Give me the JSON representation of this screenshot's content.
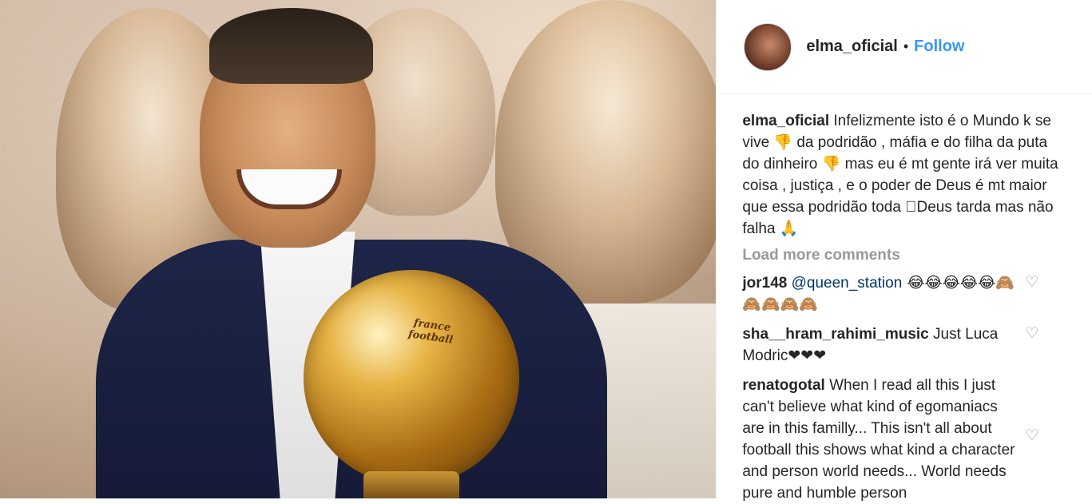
{
  "photo": {
    "trophy_text": "france football"
  },
  "header": {
    "username": "elma_oficial",
    "separator": "•",
    "follow_label": "Follow"
  },
  "caption": {
    "username": "elma_oficial",
    "text": "Infelizmente isto é o Mundo k se vive 👎 da podridão , máfia e do filha da puta do dinheiro 👎 mas eu é mt gente irá ver muita coisa , justiça , e o poder de Deus é mt maior que essa podridão toda 🏻Deus tarda mas não falha 🙏"
  },
  "load_more_label": "Load more comments",
  "comments": [
    {
      "username": "jor148",
      "mention": "@queen_station",
      "text": " 😂😂😂😂😂🙈🙈🙈🙈🙈"
    },
    {
      "username": "sha__hram_rahimi_music",
      "mention": "",
      "text": " Just Luca Modric❤❤❤"
    },
    {
      "username": "renatogotal",
      "mention": "",
      "text": " When I read all this I just can't believe what kind of egomaniacs are in this familly... This isn't all about football this shows what kind a character and person world needs... World needs pure and humble person"
    }
  ],
  "colors": {
    "link_blue": "#3897f0",
    "mention_blue": "#003569",
    "muted_gray": "#999999",
    "text_dark": "#262626"
  },
  "icons": {
    "like": "heart-outline-icon"
  }
}
